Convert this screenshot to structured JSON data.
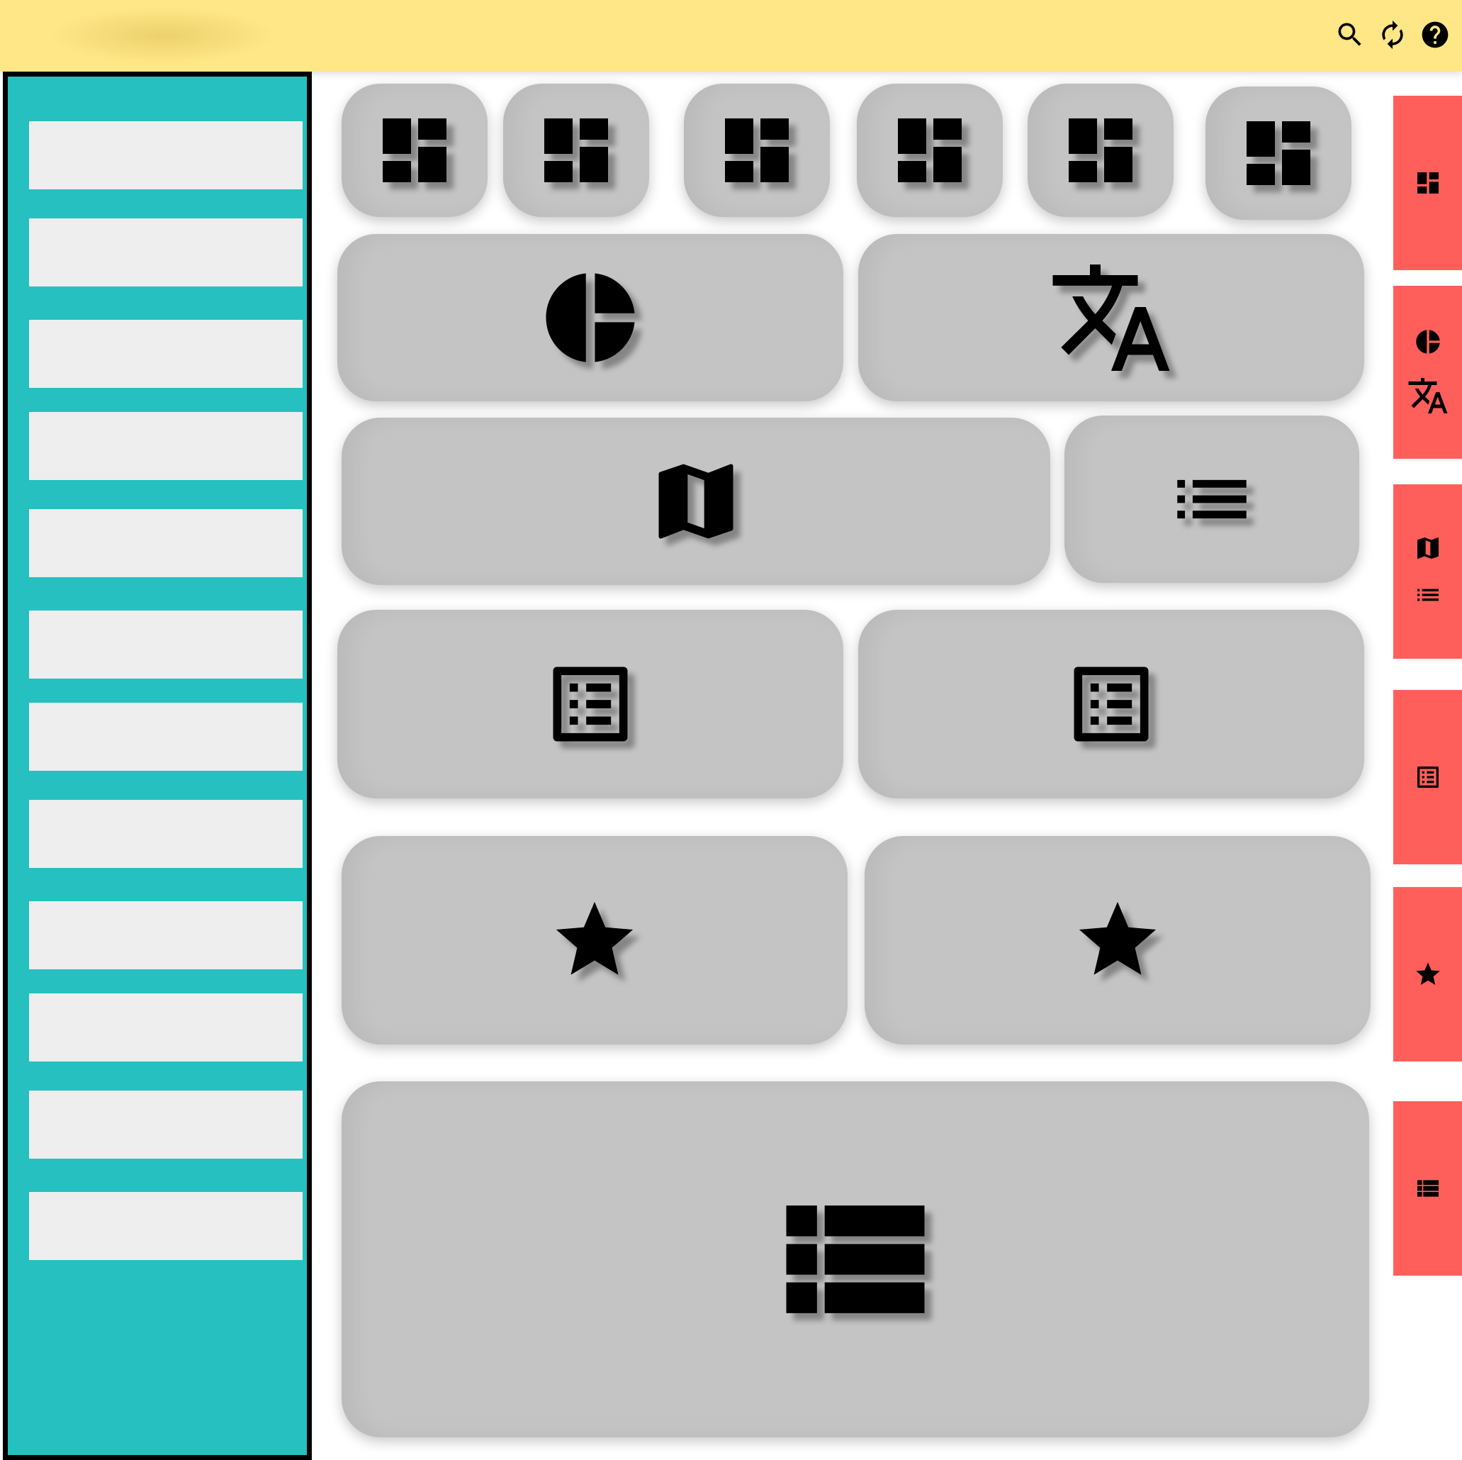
{
  "colors": {
    "topbar": "#ffe687",
    "sidebar": "#26c0c0",
    "sidebar_item": "#eeeeee",
    "tile": "#c4c4c4",
    "rail_tab": "#ff5f5b",
    "icon": "#000000"
  },
  "topbar": {
    "icons": [
      "search-icon",
      "refresh-icon",
      "help-icon"
    ]
  },
  "sidebar": {
    "item_count": 12
  },
  "tiles": [
    {
      "icon": "dashboard-icon"
    },
    {
      "icon": "dashboard-icon"
    },
    {
      "icon": "dashboard-icon"
    },
    {
      "icon": "dashboard-icon"
    },
    {
      "icon": "dashboard-icon"
    },
    {
      "icon": "dashboard-icon"
    },
    {
      "icon": "pie-chart-icon"
    },
    {
      "icon": "translate-icon"
    },
    {
      "icon": "map-icon"
    },
    {
      "icon": "list-icon"
    },
    {
      "icon": "list-alt-icon"
    },
    {
      "icon": "list-alt-icon"
    },
    {
      "icon": "star-icon"
    },
    {
      "icon": "star-icon"
    },
    {
      "icon": "view-list-icon"
    }
  ],
  "rail": {
    "tabs": [
      {
        "icons": [
          "dashboard-icon"
        ]
      },
      {
        "icons": [
          "pie-chart-icon",
          "translate-icon"
        ]
      },
      {
        "icons": [
          "map-icon",
          "list-icon"
        ]
      },
      {
        "icons": [
          "list-alt-icon"
        ]
      },
      {
        "icons": [
          "star-icon"
        ]
      },
      {
        "icons": [
          "view-list-icon"
        ]
      }
    ]
  }
}
